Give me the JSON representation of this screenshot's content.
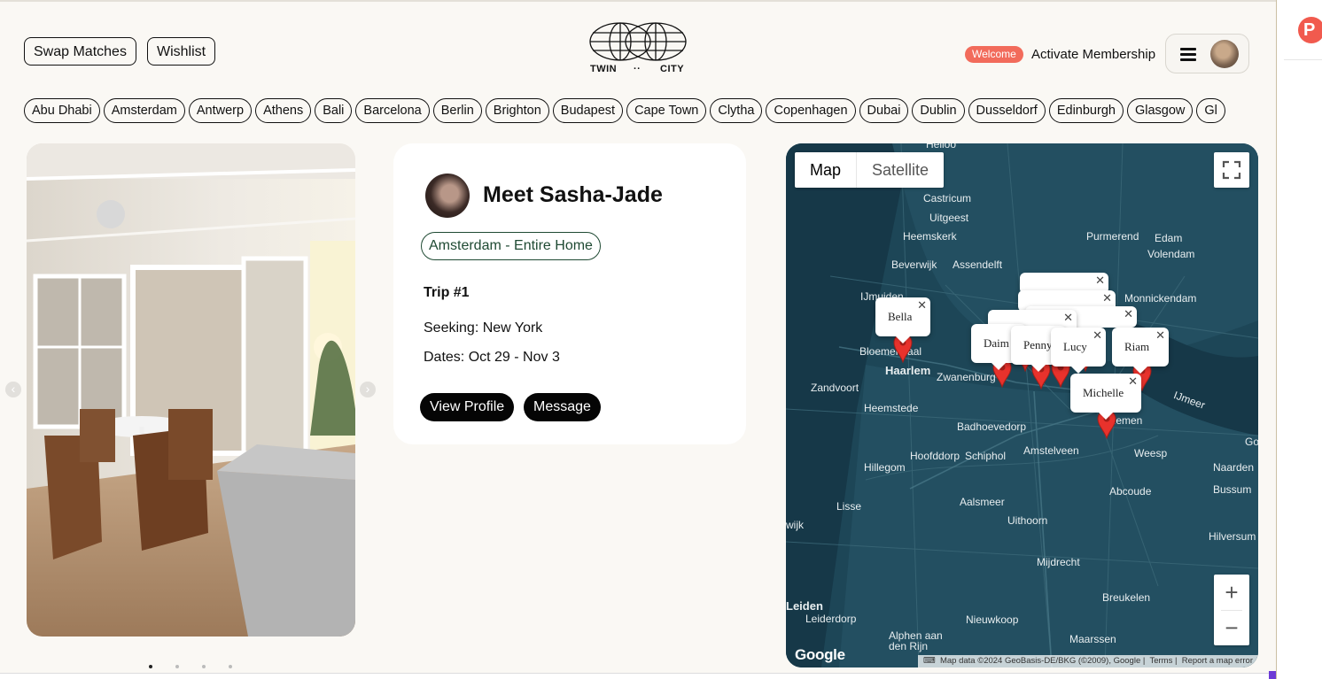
{
  "header": {
    "swap_matches": "Swap Matches",
    "wishlist": "Wishlist",
    "logo_left": "TWIN",
    "logo_mid": "··",
    "logo_right": "CITY",
    "welcome_badge": "Welcome",
    "activate_membership": "Activate Membership"
  },
  "cities": [
    "Abu Dhabi",
    "Amsterdam",
    "Antwerp",
    "Athens",
    "Bali",
    "Barcelona",
    "Berlin",
    "Brighton",
    "Budapest",
    "Cape Town",
    "Clytha",
    "Copenhagen",
    "Dubai",
    "Dublin",
    "Dusseldorf",
    "Edinburgh",
    "Glasgow",
    "Gl"
  ],
  "gallery": {
    "prev_arrow": "‹",
    "next_arrow": "›",
    "dots": 4,
    "active_dot": 1
  },
  "profile": {
    "title": "Meet Sasha-Jade",
    "listing_tag": "Amsterdam - Entire Home",
    "trip": "Trip #1",
    "seeking": "Seeking: New York",
    "dates": "Dates: Oct 29 - Nov 3",
    "view_profile": "View Profile",
    "message": "Message"
  },
  "map": {
    "type_map": "Map",
    "type_satellite": "Satellite",
    "zoom_in": "+",
    "zoom_out": "−",
    "google": "Google",
    "attribution": "Map data ©2024 GeoBasis-DE/BKG (©2009), Google",
    "terms": "Terms",
    "report": "Report a map error",
    "places": [
      "Helloo",
      "Castricum",
      "Uitgeest",
      "Heemskerk",
      "Purmerend",
      "Edam",
      "Volendam",
      "Beverwijk",
      "Assendelft",
      "IJmuiden",
      "Monnickendam",
      "Bloemendaal",
      "Haarlem",
      "Zwanenburg",
      "Zandvoort",
      "Heemstede",
      "Badhoevedorp",
      "Diemen",
      "IJmeer",
      "Hoofddorp",
      "Schiphol",
      "Amstelveen",
      "Weesp",
      "Hillegom",
      "Abcoude",
      "Naarden",
      "Bussum",
      "Lisse",
      "Aalsmeer",
      "Uithoorn",
      "Hilversum",
      "Mijdrecht",
      "Breukelen",
      "Leiden",
      "Leiderdorp",
      "Nieuwkoop",
      "Alphen aan den Rijn",
      "Maarssen",
      "wijk",
      "Goo"
    ],
    "info_windows": [
      "Bella",
      "Daim",
      "Penny",
      "Lucy",
      "Riam",
      "Michelle"
    ]
  },
  "colors": {
    "accent": "#f26b5b",
    "map_water": "#1e4a5c",
    "marker": "#e8322c"
  }
}
